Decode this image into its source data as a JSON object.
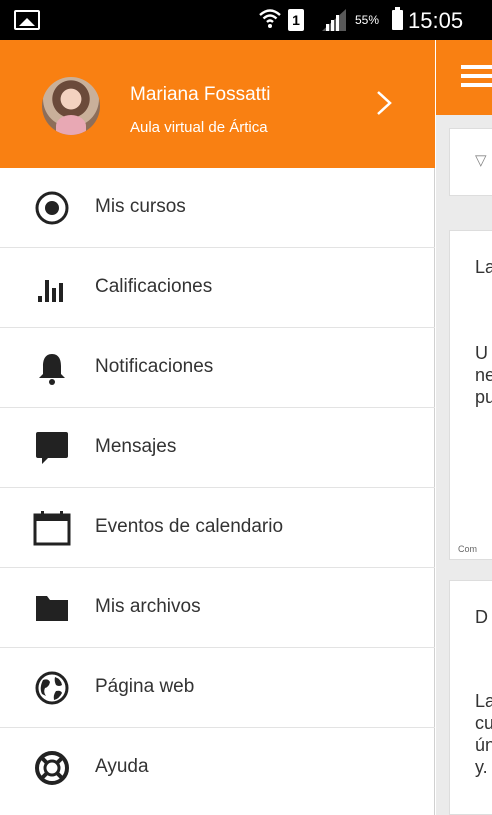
{
  "status_bar": {
    "battery_percent": "55%",
    "time": "15:05",
    "sim_slot": "1"
  },
  "drawer": {
    "header": {
      "user_name": "Mariana Fossatti",
      "site_name": "Aula virtual de Ártica",
      "background_color": "#f98012"
    },
    "items": [
      {
        "label": "Mis cursos",
        "icon": "radio-target-icon"
      },
      {
        "label": "Calificaciones",
        "icon": "bar-chart-icon"
      },
      {
        "label": "Notificaciones",
        "icon": "bell-icon"
      },
      {
        "label": "Mensajes",
        "icon": "chat-bubble-icon"
      },
      {
        "label": "Eventos de calendario",
        "icon": "calendar-icon"
      },
      {
        "label": "Mis archivos",
        "icon": "folder-icon"
      },
      {
        "label": "Página web",
        "icon": "globe-icon"
      },
      {
        "label": "Ayuda",
        "icon": "lifebuoy-icon"
      }
    ]
  },
  "background": {
    "filter_letter": "▽",
    "card1_title": "La",
    "card1_body": "U\nne\npu",
    "card1_footer": "Com",
    "card2_title": "D",
    "card2_body": "La\ncu\nún\ny."
  }
}
